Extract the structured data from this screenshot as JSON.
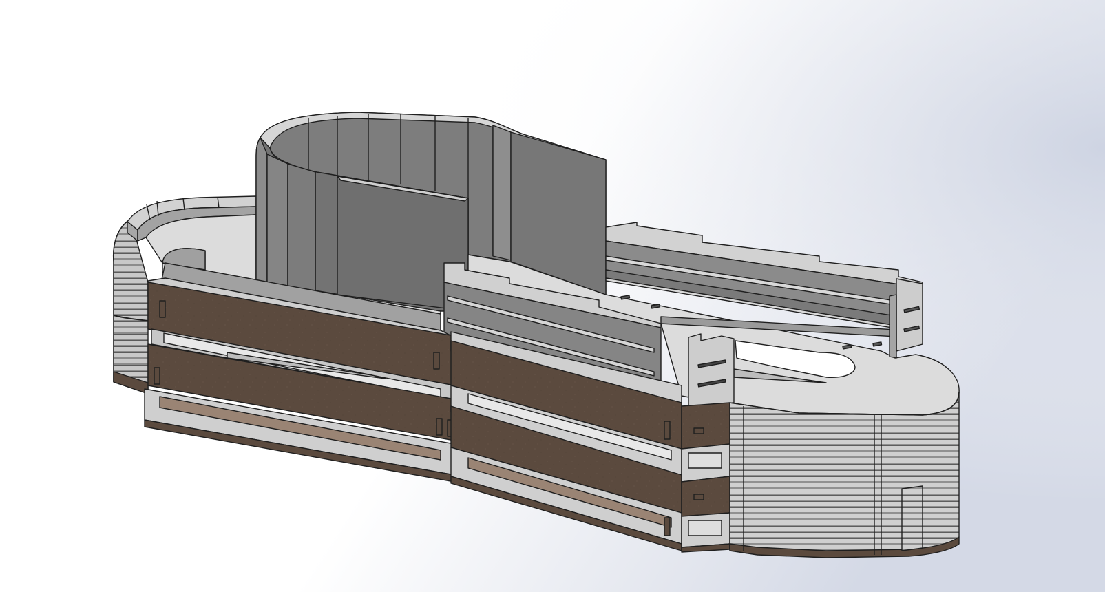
{
  "viewport": {
    "background_top": "#ffffff",
    "background_side": "#d6dbe8"
  },
  "model": {
    "colors": {
      "light": "#d4d4d4",
      "floor": "#dcdcdc",
      "mid": "#a9a9a9",
      "dark": "#7c7c7c",
      "darker": "#6e6e6e",
      "brown": "#5b4a3e",
      "brown_light": "#9a8474",
      "edge": "#1f1f1f",
      "rib_dark": "#8a8a8a",
      "rib_light": "#c9c9c9"
    }
  }
}
